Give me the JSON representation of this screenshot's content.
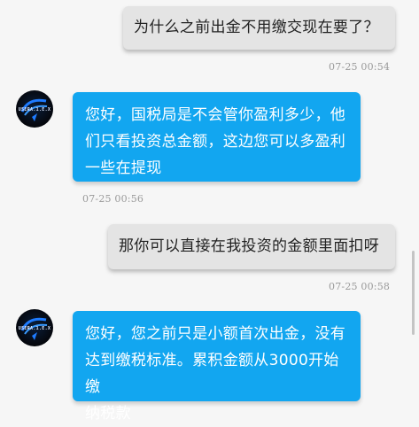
{
  "messages": [
    {
      "from": "me",
      "text": "为什么之前出金不用缴交现在要了？",
      "time": "07-25 00:54"
    },
    {
      "from": "agent",
      "lines": [
        "您好，国税局是不会管你盈利多少，他",
        "们只看投资总金额，这边您可以多盈利",
        "一些在提现"
      ],
      "time": "07-25 00:56"
    },
    {
      "from": "me",
      "text": "那你可以直接在我投资的金额里面扣呀",
      "time": "07-25 00:58"
    },
    {
      "from": "agent",
      "lines": [
        "您好，您之前只是小额首次出金，没有",
        "达到缴税标准。累积金额从3000开始缴",
        "纳税款"
      ]
    }
  ],
  "avatar": {
    "caption": "USERA.1.E.X"
  },
  "colors": {
    "incoming_bubble": "#12a6f0",
    "outgoing_bubble": "#e4e4e4",
    "background": "#f6f6f6",
    "timestamp": "#9a9a9a"
  }
}
